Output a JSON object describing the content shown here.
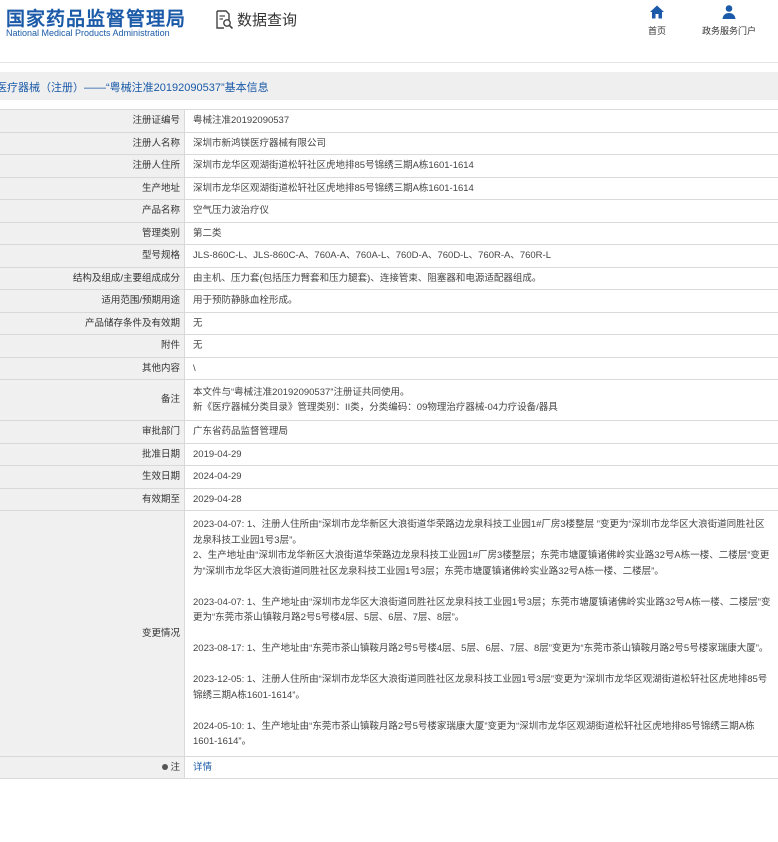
{
  "header": {
    "logo_cn": "国家药品监督管理局",
    "logo_en": "National Medical Products Administration",
    "query_label": "数据查询",
    "nav_home": "首页",
    "nav_portal": "政务服务门户"
  },
  "title": "医疗器械（注册）——“粤械注准20192090537”基本信息",
  "fields": [
    {
      "label": "注册证编号",
      "value": "粤械注准20192090537"
    },
    {
      "label": "注册人名称",
      "value": "深圳市新鸿镁医疗器械有限公司"
    },
    {
      "label": "注册人住所",
      "value": "深圳市龙华区观湖街道松轩社区虎地排85号锦绣三期A栋1601-1614"
    },
    {
      "label": "生产地址",
      "value": "深圳市龙华区观湖街道松轩社区虎地排85号锦绣三期A栋1601-1614"
    },
    {
      "label": "产品名称",
      "value": "空气压力波治疗仪"
    },
    {
      "label": "管理类别",
      "value": "第二类"
    },
    {
      "label": "型号规格",
      "value": "JLS-860C-L、JLS-860C-A、760A-A、760A-L、760D-A、760D-L、760R-A、760R-L"
    },
    {
      "label": "结构及组成/主要组成成分",
      "value": "由主机、压力套(包括压力臂套和压力腿套)、连接管束、阻塞器和电源适配器组成。"
    },
    {
      "label": "适用范围/预期用途",
      "value": "用于预防静脉血栓形成。"
    },
    {
      "label": "产品储存条件及有效期",
      "value": "无"
    },
    {
      "label": "附件",
      "value": "无"
    },
    {
      "label": "其他内容",
      "value": "\\"
    },
    {
      "label": "备注",
      "value_lines": [
        "本文件与“粤械注准20192090537”注册证共同使用。",
        "新《医疗器械分类目录》管理类别：II类，分类编码：09物理治疗器械-04力疗设备/器具"
      ]
    },
    {
      "label": "审批部门",
      "value": "广东省药品监督管理局"
    },
    {
      "label": "批准日期",
      "value": "2019-04-29"
    },
    {
      "label": "生效日期",
      "value": "2024-04-29"
    },
    {
      "label": "有效期至",
      "value": "2029-04-28"
    }
  ],
  "changes": {
    "label": "变更情况",
    "entries": [
      "2023-04-07: 1、注册人住所由“深圳市龙华新区大浪街道华荣路边龙泉科技工业园1#厂房3楼整层 ”变更为“深圳市龙华区大浪街道同胜社区龙泉科技工业园1号3层”。",
      "2、生产地址由“深圳市龙华新区大浪街道华荣路边龙泉科技工业园1#厂房3楼整层；东莞市塘厦镇诸佛岭实业路32号A栋一楼、二楼层”变更为“深圳市龙华区大浪街道同胜社区龙泉科技工业园1号3层；东莞市塘厦镇诸佛岭实业路32号A栋一楼、二楼层”。",
      "2023-04-07: 1、生产地址由“深圳市龙华区大浪街道同胜社区龙泉科技工业园1号3层；东莞市塘厦镇诸佛岭实业路32号A栋一楼、二楼层”变更为“东莞市茶山镇鞍月路2号5号楼4层、5层、6层、7层、8层”。",
      "2023-08-17: 1、生产地址由“东莞市茶山镇鞍月路2号5号楼4层、5层、6层、7层、8层”变更为“东莞市茶山镇鞍月路2号5号楼家瑞康大厦”。",
      "2023-12-05: 1、注册人住所由“深圳市龙华区大浪街道同胜社区龙泉科技工业园1号3层”变更为“深圳市龙华区观湖街道松轩社区虎地排85号锦绣三期A栋1601-1614”。",
      "2024-05-10: 1、生产地址由“东莞市茶山镇鞍月路2号5号楼家瑞康大厦”变更为“深圳市龙华区观湖街道松轩社区虎地排85号锦绣三期A栋1601-1614”。"
    ]
  },
  "note": {
    "label": "注",
    "link": "详情"
  }
}
